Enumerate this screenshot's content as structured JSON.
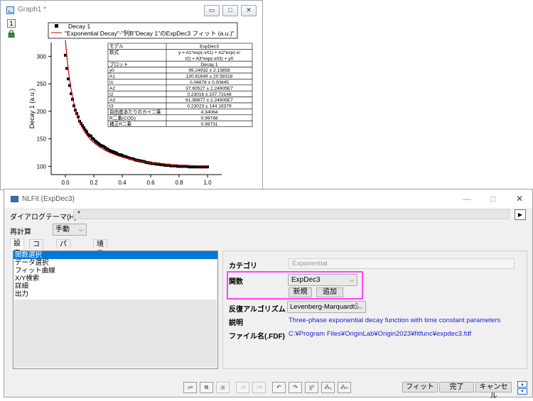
{
  "graph_window": {
    "title": "Graph1 *",
    "buttons": [
      "▭",
      "□",
      "✕"
    ],
    "layer_number": "1",
    "legend": {
      "series": "Decay 1",
      "fit": "\"Exponential Decay\"-\"列B\"Decay 1\"のExpDec3 フィット (a.u.)\""
    },
    "ylabel": "Decay 1 (a.u.)",
    "colors": {
      "data": "#000000",
      "fit": "#cc0000"
    },
    "table": [
      [
        "モデル",
        "ExpDec3"
      ],
      [
        "数式",
        "y = A1*exp(-x/t1) + A2*exp(-x/",
        "t2) + A3*exp(-x/t3) + y0"
      ],
      [
        "プロット",
        "Decay 1"
      ],
      [
        "y0",
        "99.24932 ± 2.13858"
      ],
      [
        "A1",
        "130.81649 ± 20.58318"
      ],
      [
        "t1",
        "0.04876 ± 0.00645"
      ],
      [
        "A2",
        "37.60527 ± 2.24905E7"
      ],
      [
        "t2",
        "0.23016 ± 237.73148"
      ],
      [
        "A3",
        "61.99877 ± 2.24905E7"
      ],
      [
        "t3",
        "0.23023 ± 144.16379"
      ],
      [
        "自由度あたりのカイ二乗",
        "4.34064"
      ],
      [
        "R二乗(COD)",
        "0.99748"
      ],
      [
        "補正R二乗",
        "0.99731"
      ]
    ]
  },
  "chart_data": {
    "type": "scatter",
    "title": "",
    "xlabel": "",
    "ylabel": "Decay 1 (a.u.)",
    "xlim": [
      -0.1,
      1.1
    ],
    "ylim": [
      85,
      325
    ],
    "xticks": [
      "0.0",
      "0.2",
      "0.4",
      "0.6",
      "0.8",
      "1.0"
    ],
    "yticks": [
      "100",
      "150",
      "200",
      "250",
      "300"
    ],
    "series": [
      {
        "name": "Decay 1",
        "x": [
          0.0,
          0.01,
          0.02,
          0.03,
          0.04,
          0.05,
          0.06,
          0.07,
          0.08,
          0.09,
          0.1,
          0.11,
          0.12,
          0.13,
          0.14,
          0.15,
          0.16,
          0.17,
          0.18,
          0.19,
          0.2,
          0.21,
          0.22,
          0.23,
          0.24,
          0.25,
          0.26,
          0.27,
          0.28,
          0.29,
          0.3,
          0.31,
          0.32,
          0.33,
          0.34,
          0.35,
          0.36,
          0.37,
          0.38,
          0.39,
          0.4,
          0.41,
          0.42,
          0.43,
          0.44,
          0.45,
          0.46,
          0.47,
          0.48,
          0.49,
          0.5,
          0.51,
          0.52,
          0.53,
          0.54,
          0.55,
          0.56,
          0.57,
          0.58,
          0.59,
          0.6,
          0.61,
          0.62,
          0.63,
          0.64,
          0.65,
          0.66,
          0.67,
          0.68,
          0.69,
          0.7,
          0.71,
          0.72,
          0.73,
          0.74,
          0.75,
          0.76,
          0.77,
          0.78,
          0.79,
          0.8,
          0.81,
          0.82,
          0.83,
          0.84,
          0.85,
          0.86,
          0.87,
          0.88,
          0.89,
          0.9,
          0.91,
          0.92,
          0.93,
          0.94,
          0.95,
          0.96,
          0.97,
          0.98,
          0.99,
          1.0
        ],
        "y": [
          302,
          278,
          259,
          247,
          232,
          222,
          210,
          202,
          196,
          190,
          182,
          178,
          174,
          170,
          166,
          163,
          158,
          156,
          155,
          151,
          149,
          146,
          144,
          142,
          140,
          138,
          137,
          136,
          134,
          132,
          131,
          129,
          128,
          127,
          126,
          125,
          124,
          122,
          121,
          121,
          120,
          118,
          118,
          117,
          116,
          115,
          114,
          114,
          113,
          112,
          111,
          111,
          110,
          110,
          109,
          109,
          108,
          107,
          107,
          106,
          106,
          105,
          105,
          105,
          104,
          104,
          104,
          103,
          103,
          103,
          102,
          102,
          102,
          102,
          101,
          101,
          101,
          101,
          101,
          100,
          100,
          100,
          100,
          100,
          100,
          100,
          100,
          99,
          99,
          99,
          99,
          99,
          99,
          99,
          99,
          99,
          99,
          99,
          99,
          99,
          99
        ]
      },
      {
        "name": "\"Exponential Decay\"-\"列B\"Decay 1\"のExpDec3 フィット (a.u.)",
        "model": "ExpDec3",
        "params": {
          "y0": 99.24932,
          "A1": 130.81649,
          "t1": 0.04876,
          "A2": 37.60527,
          "t2": 0.23016,
          "A3": 61.99877,
          "t3": 0.23023
        }
      }
    ]
  },
  "nlfit": {
    "title": "NLFit (ExpDec3)",
    "window_buttons": [
      "—",
      "□",
      "✕"
    ],
    "theme_label": "ダイアログテーマ(H)",
    "theme_value": "*",
    "recalc_label": "再計算",
    "recalc_value": "手動",
    "tabs": [
      "設定",
      "コード",
      "パラメータ",
      "境界"
    ],
    "tree_items": [
      "関数選択",
      "データ選択",
      "フィット曲線",
      "X/Y検索",
      "詳細",
      "出力"
    ],
    "category_label": "カテゴリ",
    "category_value": "Exponential",
    "function_label": "関数",
    "function_value": "ExpDec3",
    "new_button": "新規",
    "add_button": "追加",
    "algorithm_label": "反復アルゴリズム",
    "algorithm_value": "Levenberg-Marquardt法",
    "description_label": "説明",
    "description_value": "Three-phase exponential decay function with time constant parameters",
    "filename_label": "ファイル名(.FDF)",
    "filename_value": "C:¥Program Files¥OriginLab¥Origin2023¥fitfunc¥expdec3.fdf",
    "toolbar_icons": [
      "fit-report-icon",
      "copy-icon",
      "save-icon",
      "param-up-icon",
      "param-down-icon",
      "undo-icon",
      "redo-icon",
      "chi-square-icon",
      "one-iteration-icon",
      "fit-until-converged-icon"
    ],
    "buttons": {
      "fit": "フィット",
      "done": "完了",
      "cancel": "キャンセル"
    },
    "accent_color": "#0078d7",
    "highlight_color": "#ff44ff",
    "link_color": "#2222cc"
  }
}
